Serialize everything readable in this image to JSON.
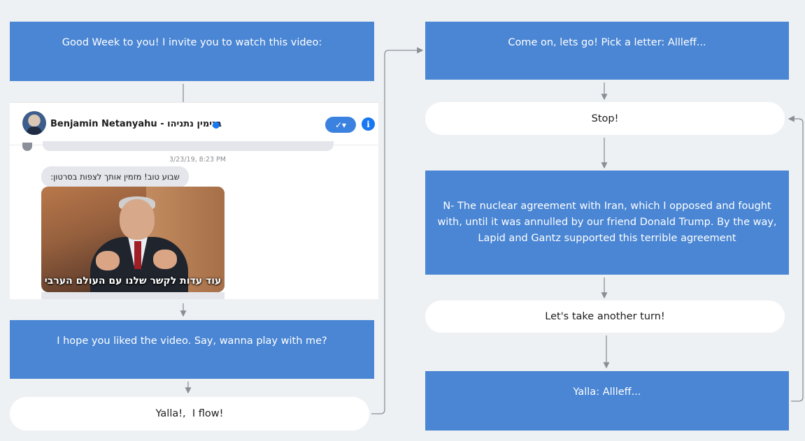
{
  "flow": {
    "left": {
      "greeting": "Good Week to you! I invite you to watch this video:",
      "liked_video": "I hope you liked the video. Say, wanna play with me?",
      "reply_flow": "Yalla!,  I flow!"
    },
    "right": {
      "pick_letter": "Come on, lets go! Pick a letter: Allleff...",
      "stop": "Stop!",
      "nuclear": "N- The nuclear agreement with Iran, which I opposed and fought with, until it was annulled by our friend Donald Trump. By the way, Lapid and Gantz supported this terrible agreement",
      "another_turn": "Let's take another turn!",
      "yalla_allleff": "Yalla: Allleff..."
    }
  },
  "screenshot": {
    "page_name": "Benjamin Netanyahu - בנימין נתניהו",
    "timestamp": "3/23/19, 8:23 PM",
    "message": "שבוע טוב! מזמין אותך לצפות בסרטון:",
    "video_caption": "עוד עדות לקשר שלנו עם העולם הערבי",
    "verified_icon": "verified-badge-icon",
    "check_icon": "checkmark-dropdown-icon",
    "info_icon_glyph": "i"
  },
  "colors": {
    "box_blue": "#4a86d4",
    "background": "#eef1f4",
    "messenger_blue": "#1877f2"
  }
}
